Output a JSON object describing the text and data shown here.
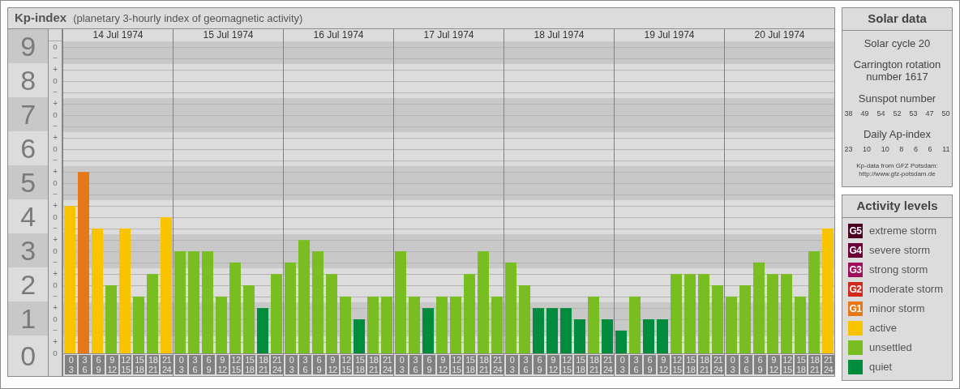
{
  "kp_panel": {
    "title": "Kp-index",
    "subtitle": "(planetary 3-hourly index of geomagnetic activity)",
    "minor_tick_labels": [
      "o",
      "−",
      "+",
      "o",
      "−",
      "+",
      "o",
      "−",
      "+",
      "o",
      "−",
      "+",
      "o",
      "−",
      "+",
      "o",
      "−",
      "+",
      "o",
      "−",
      "+",
      "o",
      "−",
      "+",
      "o",
      "−",
      "+",
      "o"
    ],
    "days": [
      {
        "date": "14 Jul 1974",
        "slots": [
          {
            "from": "0",
            "to": "3"
          },
          {
            "from": "3",
            "to": "6"
          },
          {
            "from": "6",
            "to": "9"
          },
          {
            "from": "9",
            "to": "12"
          },
          {
            "from": "12",
            "to": "15"
          },
          {
            "from": "15",
            "to": "18"
          },
          {
            "from": "18",
            "to": "21"
          },
          {
            "from": "21",
            "to": "24"
          }
        ]
      },
      {
        "date": "15 Jul 1974",
        "slots": [
          {
            "from": "0",
            "to": "3"
          },
          {
            "from": "3",
            "to": "6"
          },
          {
            "from": "6",
            "to": "9"
          },
          {
            "from": "9",
            "to": "12"
          },
          {
            "from": "12",
            "to": "15"
          },
          {
            "from": "15",
            "to": "18"
          },
          {
            "from": "18",
            "to": "21"
          },
          {
            "from": "21",
            "to": "24"
          }
        ]
      },
      {
        "date": "16 Jul 1974",
        "slots": [
          {
            "from": "0",
            "to": "3"
          },
          {
            "from": "3",
            "to": "6"
          },
          {
            "from": "6",
            "to": "9"
          },
          {
            "from": "9",
            "to": "12"
          },
          {
            "from": "12",
            "to": "15"
          },
          {
            "from": "15",
            "to": "18"
          },
          {
            "from": "18",
            "to": "21"
          },
          {
            "from": "21",
            "to": "24"
          }
        ]
      },
      {
        "date": "17 Jul 1974",
        "slots": [
          {
            "from": "0",
            "to": "3"
          },
          {
            "from": "3",
            "to": "6"
          },
          {
            "from": "6",
            "to": "9"
          },
          {
            "from": "9",
            "to": "12"
          },
          {
            "from": "12",
            "to": "15"
          },
          {
            "from": "15",
            "to": "18"
          },
          {
            "from": "18",
            "to": "21"
          },
          {
            "from": "21",
            "to": "24"
          }
        ]
      },
      {
        "date": "18 Jul 1974",
        "slots": [
          {
            "from": "0",
            "to": "3"
          },
          {
            "from": "3",
            "to": "6"
          },
          {
            "from": "6",
            "to": "9"
          },
          {
            "from": "9",
            "to": "12"
          },
          {
            "from": "12",
            "to": "15"
          },
          {
            "from": "15",
            "to": "18"
          },
          {
            "from": "18",
            "to": "21"
          },
          {
            "from": "21",
            "to": "24"
          }
        ]
      },
      {
        "date": "19 Jul 1974",
        "slots": [
          {
            "from": "0",
            "to": "3"
          },
          {
            "from": "3",
            "to": "6"
          },
          {
            "from": "6",
            "to": "9"
          },
          {
            "from": "9",
            "to": "12"
          },
          {
            "from": "12",
            "to": "15"
          },
          {
            "from": "15",
            "to": "18"
          },
          {
            "from": "18",
            "to": "21"
          },
          {
            "from": "21",
            "to": "24"
          }
        ]
      },
      {
        "date": "20 Jul 1974",
        "slots": [
          {
            "from": "0",
            "to": "3"
          },
          {
            "from": "3",
            "to": "6"
          },
          {
            "from": "6",
            "to": "9"
          },
          {
            "from": "9",
            "to": "12"
          },
          {
            "from": "12",
            "to": "15"
          },
          {
            "from": "15",
            "to": "18"
          },
          {
            "from": "18",
            "to": "21"
          },
          {
            "from": "21",
            "to": "24"
          }
        ]
      }
    ],
    "chart_data": {
      "type": "bar",
      "grid": true,
      "bands": [
        {
          "axis": "y",
          "from": 8.5,
          "to": 9.17
        },
        {
          "axis": "y",
          "from": 6.5,
          "to": 7.5
        },
        {
          "axis": "y",
          "from": 4.5,
          "to": 5.5
        },
        {
          "axis": "y",
          "from": 2.5,
          "to": 3.5
        },
        {
          "axis": "y",
          "from": 0.5,
          "to": 1.5
        }
      ],
      "ylim": [
        0,
        9.17
      ],
      "yticks": [
        {
          "value": 0,
          "label": "0"
        },
        {
          "value": 1,
          "label": "1"
        },
        {
          "value": 2,
          "label": "2"
        },
        {
          "value": 3,
          "label": "3"
        },
        {
          "value": 4,
          "label": "4"
        },
        {
          "value": 5,
          "label": "5"
        },
        {
          "value": 6,
          "label": "6"
        },
        {
          "value": 7,
          "label": "7"
        },
        {
          "value": 8,
          "label": "8"
        },
        {
          "value": 9,
          "label": "9"
        }
      ],
      "series": [
        {
          "color": "#e67818",
          "values": [
            null,
            5.33,
            null,
            null,
            null,
            null,
            null,
            null,
            null,
            null,
            null,
            null,
            null,
            null,
            null,
            null,
            null,
            null,
            null,
            null,
            null,
            null,
            null,
            null,
            null,
            null,
            null,
            null,
            null,
            null,
            null,
            null,
            null,
            null,
            null,
            null,
            null,
            null,
            null,
            null,
            null,
            null,
            null,
            null,
            null,
            null,
            null,
            null,
            null,
            null,
            null,
            null,
            null,
            null,
            null,
            null
          ]
        },
        {
          "color": "#f8c400",
          "values": [
            4.33,
            null,
            3.67,
            null,
            3.67,
            null,
            null,
            4,
            null,
            null,
            null,
            null,
            null,
            null,
            null,
            null,
            null,
            null,
            null,
            null,
            null,
            null,
            null,
            null,
            null,
            null,
            null,
            null,
            null,
            null,
            null,
            null,
            null,
            null,
            null,
            null,
            null,
            null,
            null,
            null,
            null,
            null,
            null,
            null,
            null,
            null,
            null,
            null,
            null,
            null,
            null,
            null,
            null,
            null,
            null,
            3.67
          ]
        },
        {
          "color": "#78be20",
          "values": [
            null,
            null,
            null,
            2,
            null,
            1.67,
            2.33,
            null,
            3,
            3,
            3,
            1.67,
            2.67,
            2,
            null,
            2.33,
            2.67,
            3.33,
            3,
            2.33,
            1.67,
            null,
            1.67,
            1.67,
            3,
            1.67,
            null,
            1.67,
            1.67,
            2.33,
            3,
            1.67,
            2.67,
            2,
            null,
            null,
            null,
            null,
            1.67,
            null,
            null,
            1.67,
            null,
            null,
            2.33,
            2.33,
            2.33,
            2,
            1.67,
            2,
            2.67,
            2.33,
            2.33,
            1.67,
            3,
            null
          ]
        },
        {
          "color": "#008c3c",
          "values": [
            null,
            null,
            null,
            null,
            null,
            null,
            null,
            null,
            null,
            null,
            null,
            null,
            null,
            null,
            1.33,
            null,
            null,
            null,
            null,
            null,
            null,
            1,
            null,
            null,
            null,
            null,
            1.33,
            null,
            null,
            null,
            null,
            null,
            null,
            null,
            1.33,
            1.33,
            1.33,
            1,
            null,
            1,
            0.67,
            null,
            1,
            1,
            null,
            null,
            null,
            null,
            null,
            null,
            null,
            null,
            null,
            null,
            null,
            null
          ]
        }
      ]
    }
  },
  "solar_data": {
    "title": "Solar data",
    "cycle": "Solar cycle 20",
    "carrington": "Carrington rotation number 1617",
    "sunspot_label": "Sunspot number",
    "sunspot_values": [
      "38",
      "49",
      "54",
      "52",
      "53",
      "47",
      "50"
    ],
    "ap_label": "Daily Ap-index",
    "ap_values": [
      "23",
      "10",
      "10",
      "8",
      "6",
      "6",
      "11"
    ],
    "source": "Kp-data from GFZ Potsdam:",
    "source_url": "http://www.gfz-potsdam.de"
  },
  "activity_levels": {
    "title": "Activity levels",
    "items": [
      {
        "badge": "G5",
        "label": "extreme storm",
        "color": "#4a0020"
      },
      {
        "badge": "G4",
        "label": "severe storm",
        "color": "#6a0035"
      },
      {
        "badge": "G3",
        "label": "strong storm",
        "color": "#a0105a"
      },
      {
        "badge": "G2",
        "label": "moderate storm",
        "color": "#d22a1a"
      },
      {
        "badge": "G1",
        "label": "minor storm",
        "color": "#e67818"
      },
      {
        "label": "active",
        "color": "#f8c400"
      },
      {
        "label": "unsettled",
        "color": "#78be20"
      },
      {
        "label": "quiet",
        "color": "#008c3c"
      }
    ]
  }
}
